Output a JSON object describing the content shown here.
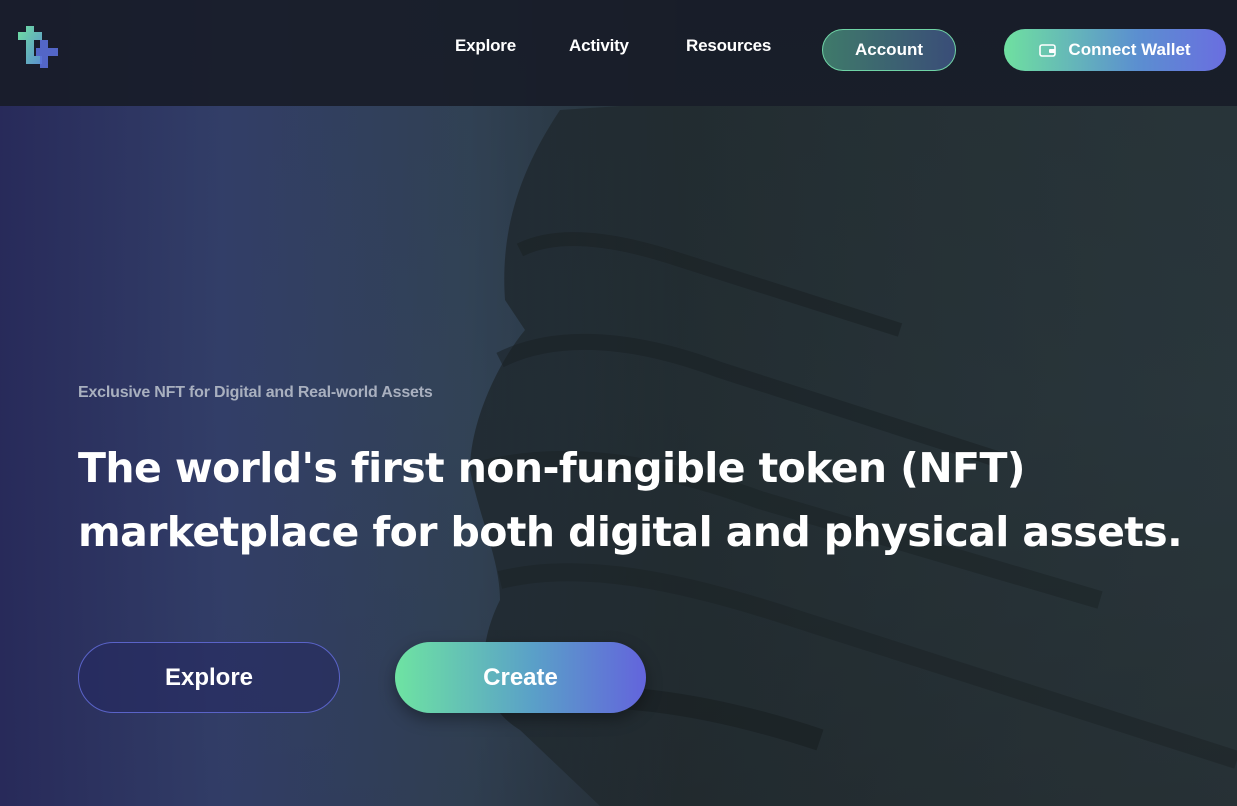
{
  "nav": {
    "items": [
      {
        "label": "Explore"
      },
      {
        "label": "Activity"
      },
      {
        "label": "Resources"
      }
    ],
    "account_label": "Account",
    "wallet_label": "Connect Wallet",
    "wallet_icon": "wallet-icon",
    "logo_icon": "brand-logo-icon"
  },
  "hero": {
    "subtitle": "Exclusive NFT for Digital and Real-world Assets",
    "headline": "The world's first non-fungible token (NFT) marketplace for both digital and physical assets.",
    "explore_label": "Explore",
    "create_label": "Create"
  },
  "colors": {
    "accent_green": "#6fe0a0",
    "accent_purple": "#6364dc",
    "nav_bg": "#181c28"
  }
}
